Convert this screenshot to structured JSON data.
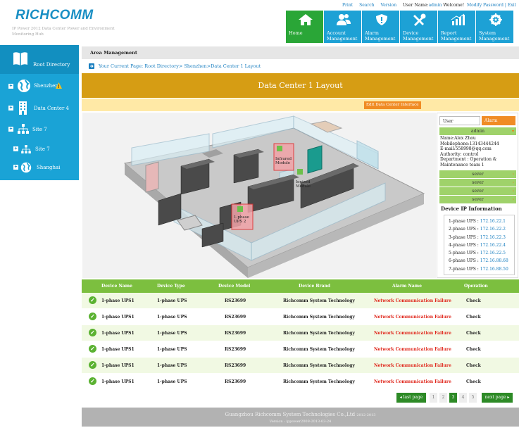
{
  "header": {
    "logo": "RICHCOMM",
    "subtitle": "IP Power 2012 Data Center Power and Environment Monitoring Hub",
    "links": [
      "Print",
      "Search",
      "Version"
    ],
    "user_label": "User Name:",
    "user_name": "admin",
    "welcome": "Welcome!",
    "modify_exit": "Modify Password | Exit"
  },
  "nav": [
    {
      "label": "Home",
      "icon": "home-icon",
      "active": true
    },
    {
      "label": "Account Management",
      "icon": "users-icon"
    },
    {
      "label": "Alarm Management",
      "icon": "alarm-shield-icon"
    },
    {
      "label": "Device Management",
      "icon": "tools-icon"
    },
    {
      "label": "Report Management",
      "icon": "bar-chart-icon"
    },
    {
      "label": "System Management",
      "icon": "gear-icon"
    }
  ],
  "sidebar": {
    "root": "Root Directory",
    "items": [
      "Shenzhen",
      "Data Center 4",
      "Site 7",
      "Site 7",
      "Shanghai"
    ]
  },
  "area_title": "Area Management",
  "breadcrumb": "Your Current Page: Root Directory> Shenzhen>Data Center 1 Layout",
  "page_title": "Data Center 1 Layout",
  "edit_button": "Edit Data Center Interface",
  "floor_labels": {
    "infrared": "Infrared Module",
    "ionized": "Ionized Module",
    "ups": "1-phase UPS 2"
  },
  "panel": {
    "tab_user": "User Information",
    "tab_alarm": "Alarm Object",
    "admin_row": "admin",
    "user_lines": [
      "Name:Alex Zhou",
      "Mobilephone:13143444244",
      "E-mail:558998@qq.com",
      "Authority: control",
      "Department : Operation & Maintenance team 1"
    ],
    "sever_rows": [
      "sever",
      "sever",
      "sever",
      "sever"
    ],
    "ip_title": "Device IP Information",
    "ips": [
      {
        "name": "1-phase UPS :",
        "ip": "172.16.22.1"
      },
      {
        "name": "2-phase UPS :",
        "ip": "172.16.22.2"
      },
      {
        "name": "3-phase UPS :",
        "ip": "172.16.22.3"
      },
      {
        "name": "4-phase UPS :",
        "ip": "172.16.22.4"
      },
      {
        "name": "5-phase UPS :",
        "ip": "172.16.22.5"
      },
      {
        "name": "6-phase UPS :",
        "ip": "172.16.88.68"
      },
      {
        "name": "7-phase UPS :",
        "ip": "172.16.88.50"
      }
    ]
  },
  "table": {
    "headers": [
      "Device Name",
      "Device Type",
      "Device Model",
      "Device Brand",
      "Alarm Name",
      "Operation"
    ],
    "rows": [
      [
        "1-phase UPS1",
        "1-phase UPS",
        "RS23699",
        "Richcomm System Technology",
        "Network Communication Failure",
        "Check"
      ],
      [
        "1-phase UPS1",
        "1-phase UPS",
        "RS23699",
        "Richcomm System Technology",
        "Network Communication Failure",
        "Check"
      ],
      [
        "1-phase UPS1",
        "1-phase UPS",
        "RS23699",
        "Richcomm System Technology",
        "Network Communication Failure",
        "Check"
      ],
      [
        "1-phase UPS1",
        "1-phase UPS",
        "RS23699",
        "Richcomm System Technology",
        "Network Communication Failure",
        "Check"
      ],
      [
        "1-phase UPS1",
        "1-phase UPS",
        "RS23699",
        "Richcomm System Technology",
        "Network Communication Failure",
        "Check"
      ],
      [
        "1-phase UPS1",
        "1-phase UPS",
        "RS23699",
        "Richcomm System Technology",
        "Network Communication Failure",
        "Check"
      ]
    ]
  },
  "pager": {
    "prev": "last page",
    "pages": [
      "1",
      "2",
      "3",
      "4",
      "5"
    ],
    "current": "3",
    "next": "next page"
  },
  "footer": {
    "line1": "Guangzhou Richcomm System Technologies Co.,Ltd",
    "line1_small": "2012-2013",
    "line2": "Version : ippower2009-2013-03-24"
  },
  "colors": {
    "nav_blue": "#1da1d5",
    "nav_active": "#2aa637",
    "title_gold": "#d69d14",
    "table_green": "#7cbf3f",
    "alarm_red": "#e0281d"
  }
}
